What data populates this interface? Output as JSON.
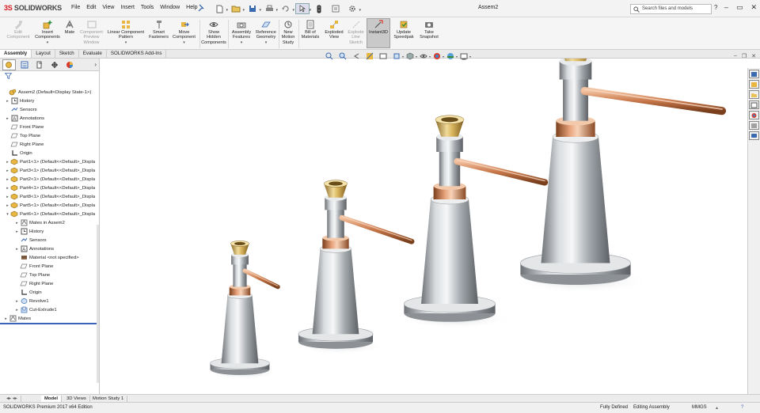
{
  "app": {
    "logo": "SOLIDWORKS",
    "logo_prefix": "3S",
    "document_title": "Assem2"
  },
  "menu": [
    "File",
    "Edit",
    "View",
    "Insert",
    "Tools",
    "Window",
    "Help"
  ],
  "search": {
    "placeholder": "Search files and models"
  },
  "ribbon": [
    {
      "label": "Edit Component",
      "enabled": false,
      "icon": "edit-component-icon"
    },
    {
      "label": "Insert Components",
      "enabled": true,
      "icon": "insert-components-icon"
    },
    {
      "label": "Mate",
      "enabled": true,
      "icon": "mate-icon"
    },
    {
      "label": "Component Preview Window",
      "enabled": false,
      "icon": "component-preview-icon"
    },
    {
      "label": "Linear Component Pattern",
      "enabled": true,
      "icon": "linear-pattern-icon"
    },
    {
      "label": "Smart Fasteners",
      "enabled": true,
      "icon": "smart-fasteners-icon"
    },
    {
      "label": "Move Component",
      "enabled": true,
      "icon": "move-component-icon"
    },
    {
      "label": "Show Hidden Components",
      "enabled": true,
      "icon": "show-hidden-icon"
    },
    {
      "label": "Assembly Features",
      "enabled": true,
      "icon": "assembly-features-icon"
    },
    {
      "label": "Reference Geometry",
      "enabled": true,
      "icon": "reference-geometry-icon"
    },
    {
      "label": "New Motion Study",
      "enabled": true,
      "icon": "motion-study-icon"
    },
    {
      "label": "Bill of Materials",
      "enabled": true,
      "icon": "bill-of-materials-icon"
    },
    {
      "label": "Exploded View",
      "enabled": true,
      "icon": "exploded-view-icon"
    },
    {
      "label": "Explode Line Sketch",
      "enabled": false,
      "icon": "explode-line-icon"
    },
    {
      "label": "Instant3D",
      "enabled": true,
      "active": true,
      "icon": "instant3d-icon"
    },
    {
      "label": "Update Speedpak",
      "enabled": true,
      "icon": "speedpak-icon"
    },
    {
      "label": "Take Snapshot",
      "enabled": true,
      "icon": "snapshot-icon"
    }
  ],
  "tabs": [
    "Assembly",
    "Layout",
    "Sketch",
    "Evaluate",
    "SOLIDWORKS Add-Ins"
  ],
  "active_tab": "Assembly",
  "tree": [
    {
      "label": "Assem2  (Default<Display State-1>)",
      "icon": "assembly-icon",
      "level": 0
    },
    {
      "label": "History",
      "icon": "history-icon",
      "level": 1,
      "expander": true
    },
    {
      "label": "Sensors",
      "icon": "sensor-icon",
      "level": 1
    },
    {
      "label": "Annotations",
      "icon": "annotations-icon",
      "level": 1,
      "expander": true
    },
    {
      "label": "Front Plane",
      "icon": "plane-icon",
      "level": 1
    },
    {
      "label": "Top Plane",
      "icon": "plane-icon",
      "level": 1
    },
    {
      "label": "Right Plane",
      "icon": "plane-icon",
      "level": 1
    },
    {
      "label": "Origin",
      "icon": "origin-icon",
      "level": 1
    },
    {
      "label": "Part1<1> (Default<<Default>_Displa",
      "icon": "part-icon",
      "level": 1,
      "expander": true
    },
    {
      "label": "Part3<1> (Default<<Default>_Displa",
      "icon": "part-icon",
      "level": 1,
      "expander": true
    },
    {
      "label": "Part2<1> (Default<<Default>_Displa",
      "icon": "part-icon",
      "level": 1,
      "expander": true
    },
    {
      "label": "Part4<1> (Default<<Default>_Displa",
      "icon": "part-icon",
      "level": 1,
      "expander": true
    },
    {
      "label": "Part8<1> (Default<<Default>_Displa",
      "icon": "part-icon",
      "level": 1,
      "expander": true
    },
    {
      "label": "Part5<1> (Default<<Default>_Displa",
      "icon": "part-icon",
      "level": 1,
      "expander": true
    },
    {
      "label": "Part6<1> (Default<<Default>_Displa",
      "icon": "part-icon",
      "level": 1,
      "expander": true,
      "expanded": true
    },
    {
      "label": "Mates in Assem2",
      "icon": "mates-icon",
      "level": 2,
      "expander": true
    },
    {
      "label": "History",
      "icon": "history-icon",
      "level": 2,
      "expander": true
    },
    {
      "label": "Sensors",
      "icon": "sensor-icon",
      "level": 2
    },
    {
      "label": "Annotations",
      "icon": "annotations-icon",
      "level": 2,
      "expander": true
    },
    {
      "label": "Material <not specified>",
      "icon": "material-icon",
      "level": 2
    },
    {
      "label": "Front Plane",
      "icon": "plane-icon",
      "level": 2
    },
    {
      "label": "Top Plane",
      "icon": "plane-icon",
      "level": 2
    },
    {
      "label": "Right Plane",
      "icon": "plane-icon",
      "level": 2
    },
    {
      "label": "Origin",
      "icon": "origin-icon",
      "level": 2
    },
    {
      "label": "Revolve1",
      "icon": "revolve-icon",
      "level": 2,
      "expander": true
    },
    {
      "label": "Cut-Extrude1",
      "icon": "cut-extrude-icon",
      "level": 2,
      "expander": true
    },
    {
      "label": "Mates",
      "icon": "mates-icon",
      "level": 0,
      "expander": true
    }
  ],
  "bottom_tabs": [
    "Model",
    "3D Views",
    "Motion Study 1"
  ],
  "status": {
    "edition": "SOLIDWORKS Premium 2017 x64 Edition",
    "definition": "Fully Defined",
    "mode": "Editing Assembly",
    "units": "MMGS"
  },
  "colors": {
    "accent": "#3b63b8",
    "brand": "#d71920",
    "steel": "#b8bcc2",
    "copper": "#c8784a",
    "brass": "#c9a84a"
  }
}
